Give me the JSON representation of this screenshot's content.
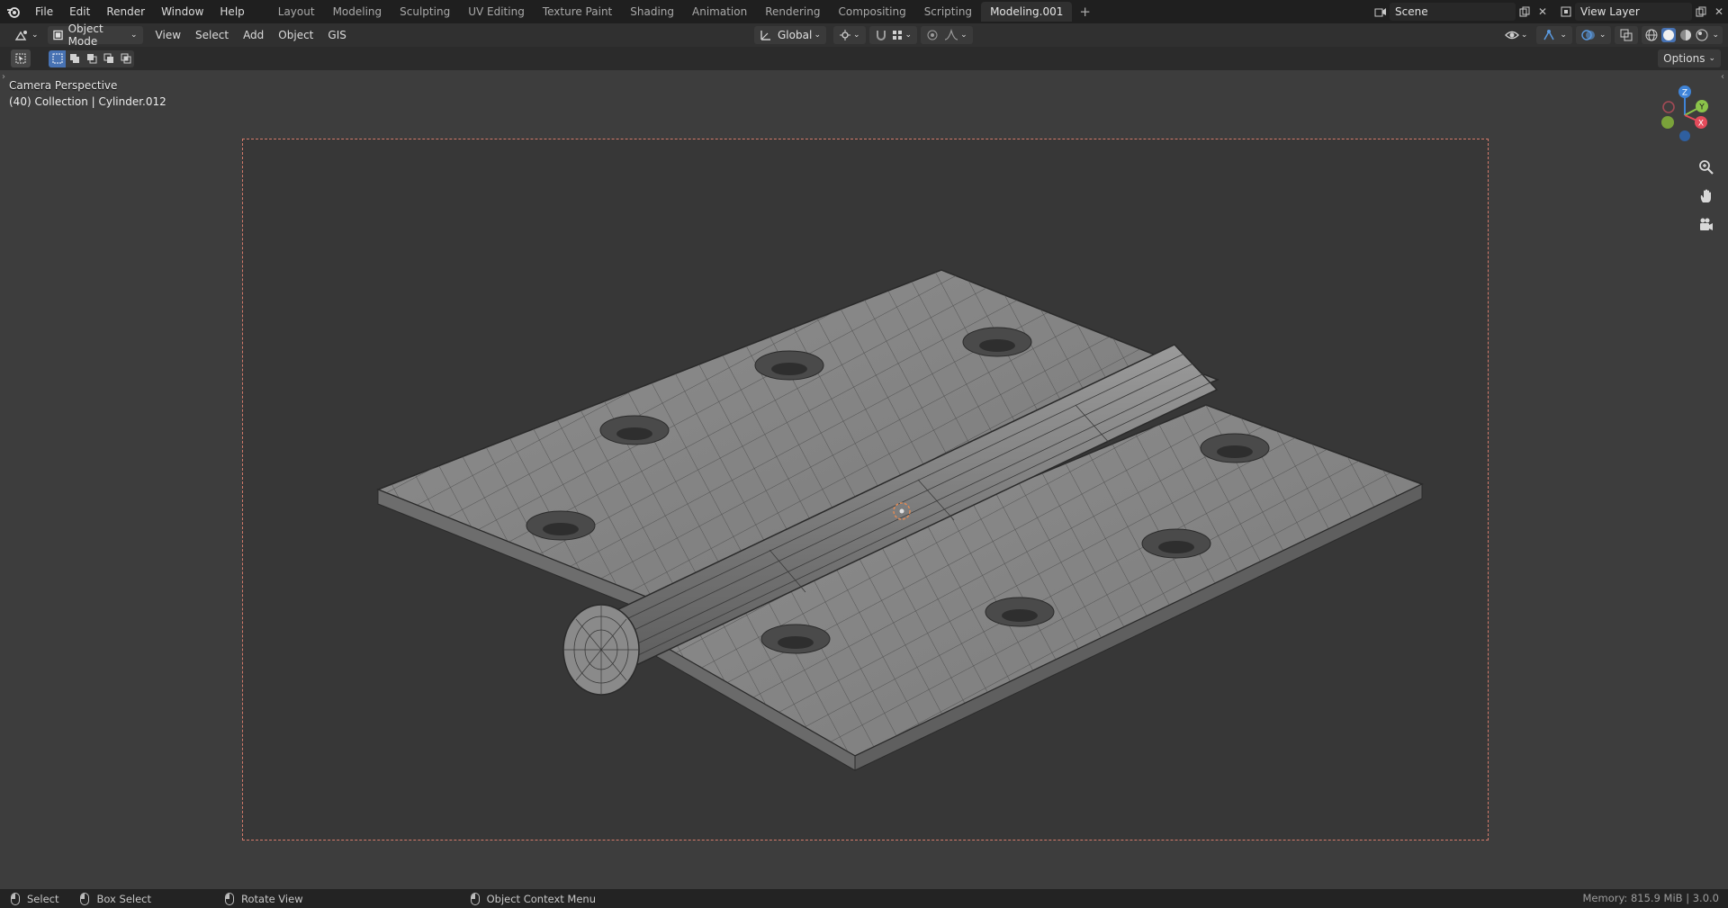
{
  "menu": {
    "items": [
      "File",
      "Edit",
      "Render",
      "Window",
      "Help"
    ]
  },
  "workspaces": {
    "tabs": [
      "Layout",
      "Modeling",
      "Sculpting",
      "UV Editing",
      "Texture Paint",
      "Shading",
      "Animation",
      "Rendering",
      "Compositing",
      "Scripting",
      "Modeling.001"
    ],
    "active": "Modeling.001",
    "add": "+"
  },
  "scene": {
    "name": "Scene"
  },
  "view_layer": {
    "name": "View Layer"
  },
  "header": {
    "mode": "Object Mode",
    "menus": [
      "View",
      "Select",
      "Add",
      "Object",
      "GIS"
    ],
    "orientation": "Global"
  },
  "toolrow": {
    "options_label": "Options"
  },
  "viewport": {
    "view_name": "Camera Perspective",
    "collection_info": "(40) Collection | Cylinder.012",
    "gizmo_axes": {
      "z": "Z",
      "y": "Y",
      "x": "X"
    }
  },
  "statusbar": {
    "select": "Select",
    "box_select": "Box Select",
    "rotate_view": "Rotate View",
    "context_menu": "Object Context Menu",
    "memory": "Memory: 815.9 MiB | 3.0.0"
  },
  "colors": {
    "accent": "#4772b3",
    "axis_x": "#e44b5b",
    "axis_y": "#8bc34a",
    "axis_z": "#3f84d8",
    "camera_frame": "#d47a6a"
  }
}
